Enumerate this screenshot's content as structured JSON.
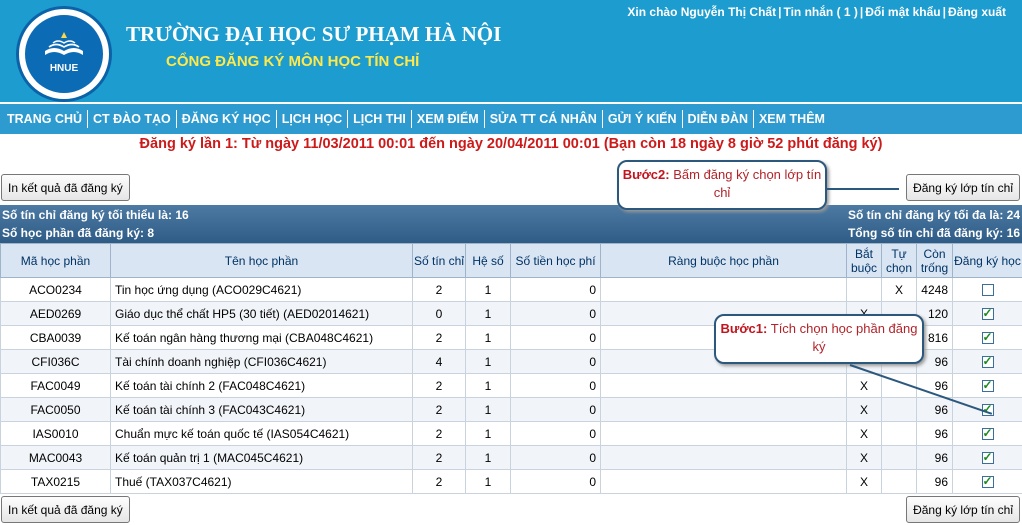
{
  "header": {
    "school_name": "TRƯỜNG ĐẠI HỌC SƯ PHẠM HÀ NỘI",
    "portal_name": "CỔNG ĐĂNG KÝ MÔN HỌC TÍN CHỈ",
    "logo_text": "HNUE",
    "user_links": [
      "Xin chào Nguyễn Thị Chất",
      "Tin nhắn ( 1 )",
      "Đổi mật khẩu",
      "Đăng xuất"
    ]
  },
  "nav": [
    "TRANG CHỦ",
    "CT ĐÀO TẠO",
    "ĐĂNG KÝ HỌC",
    "LỊCH HỌC",
    "LỊCH THI",
    "XEM ĐIỂM",
    "SỬA TT CÁ NHÂN",
    "GỬI Ý KIẾN",
    "DIỄN ĐÀN",
    "XEM THÊM"
  ],
  "registration_info": "Đăng ký lần 1: Từ ngày 11/03/2011 00:01 đến ngày 20/04/2011 00:01 (Bạn còn 18 ngày 8 giờ 52 phút đăng ký)",
  "buttons": {
    "print": "In kết quả đã đăng ký",
    "register": "Đăng ký lớp tín chỉ"
  },
  "summary": {
    "min_credits": "Số tín chỉ đăng ký tối thiểu là: 16",
    "max_credits": "Số tín chỉ đăng ký tối đa là: 24",
    "registered_courses": "Số học phần đã đăng ký: 8",
    "total_credits": "Tổng số tín chỉ đã đăng ký: 16"
  },
  "table": {
    "headers": [
      "Mã học phần",
      "Tên học phần",
      "Số tín chỉ",
      "Hệ số",
      "Số tiền học phí",
      "Ràng buộc học phần",
      "Bắt buộc",
      "Tự chọn",
      "Còn trống",
      "Đăng ký học"
    ],
    "rows": [
      {
        "code": "ACO0234",
        "name": "Tin học ứng dụng (ACO029C4621)",
        "credits": "2",
        "coef": "1",
        "fee": "0",
        "constraint": "",
        "required": "",
        "elective": "X",
        "remaining": "4248",
        "checked": false
      },
      {
        "code": "AED0269",
        "name": "Giáo dục thể chất HP5 (30 tiết) (AED02014621)",
        "credits": "0",
        "coef": "1",
        "fee": "0",
        "constraint": "",
        "required": "X",
        "elective": "",
        "remaining": "120",
        "checked": true
      },
      {
        "code": "CBA0039",
        "name": "Kế toán ngân hàng thương mại (CBA048C4621)",
        "credits": "2",
        "coef": "1",
        "fee": "0",
        "constraint": "",
        "required": "",
        "elective": "",
        "remaining": "816",
        "checked": true
      },
      {
        "code": "CFI036C",
        "name": "Tài chính doanh nghiệp (CFI036C4621)",
        "credits": "4",
        "coef": "1",
        "fee": "0",
        "constraint": "",
        "required": "",
        "elective": "",
        "remaining": "96",
        "checked": true
      },
      {
        "code": "FAC0049",
        "name": "Kế toán tài chính 2 (FAC048C4621)",
        "credits": "2",
        "coef": "1",
        "fee": "0",
        "constraint": "",
        "required": "X",
        "elective": "",
        "remaining": "96",
        "checked": true
      },
      {
        "code": "FAC0050",
        "name": "Kế toán tài chính 3 (FAC043C4621)",
        "credits": "2",
        "coef": "1",
        "fee": "0",
        "constraint": "",
        "required": "X",
        "elective": "",
        "remaining": "96",
        "checked": true
      },
      {
        "code": "IAS0010",
        "name": "Chuẩn mực kế toán quốc tế (IAS054C4621)",
        "credits": "2",
        "coef": "1",
        "fee": "0",
        "constraint": "",
        "required": "X",
        "elective": "",
        "remaining": "96",
        "checked": true
      },
      {
        "code": "MAC0043",
        "name": "Kế toán quản trị 1 (MAC045C4621)",
        "credits": "2",
        "coef": "1",
        "fee": "0",
        "constraint": "",
        "required": "X",
        "elective": "",
        "remaining": "96",
        "checked": true
      },
      {
        "code": "TAX0215",
        "name": "Thuế (TAX037C4621)",
        "credits": "2",
        "coef": "1",
        "fee": "0",
        "constraint": "",
        "required": "X",
        "elective": "",
        "remaining": "96",
        "checked": true
      }
    ]
  },
  "callouts": {
    "step2_title": "Bước2:",
    "step2_text": "Bấm đăng ký chọn lớp tín chỉ",
    "step1_title": "Bước1:",
    "step1_text": "Tích chọn học phần đăng ký"
  },
  "colors": {
    "header_bg": "#1d9ccf",
    "title_yellow": "#ffe94a",
    "info_red": "#cc1a1a",
    "summary_bar": "#3a6a94"
  }
}
